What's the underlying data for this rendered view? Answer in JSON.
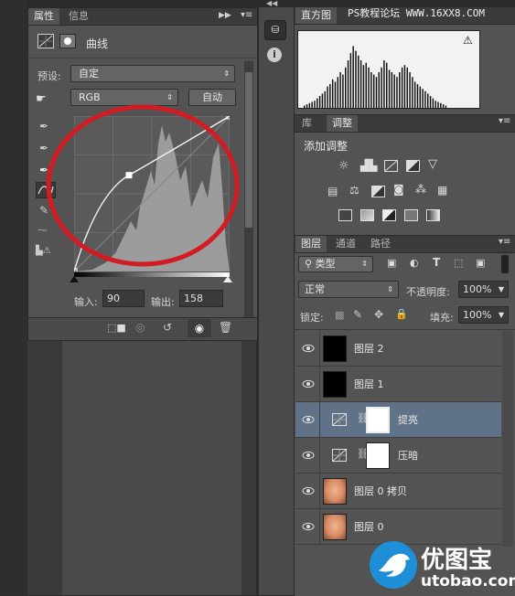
{
  "watermark_top": "PS教程论坛 WWW.16XX8.COM",
  "properties": {
    "tabs": [
      "属性",
      "信息"
    ],
    "title": "曲线",
    "preset_label": "预设:",
    "preset_value": "自定",
    "channel_value": "RGB",
    "auto_button": "自动",
    "input_label": "输入:",
    "input_value": "90",
    "output_label": "输出:",
    "output_value": "158",
    "curve_points": [
      [
        0,
        0
      ],
      [
        90,
        158
      ],
      [
        255,
        255
      ]
    ]
  },
  "histogram": {
    "tab": "直方图"
  },
  "adjustments": {
    "tabs": [
      "库",
      "调整"
    ],
    "add_label": "添加调整"
  },
  "layers": {
    "tabs": [
      "图层",
      "通道",
      "路径"
    ],
    "filter_label": "类型",
    "blend_mode": "正常",
    "opacity_label": "不透明度:",
    "opacity_value": "100%",
    "lock_label": "锁定:",
    "fill_label": "填充:",
    "fill_value": "100%",
    "items": [
      {
        "name": "图层 2"
      },
      {
        "name": "图层 1"
      },
      {
        "name": "提亮"
      },
      {
        "name": "压暗"
      },
      {
        "name": "图层 0 拷贝"
      },
      {
        "name": "图层 0"
      }
    ]
  },
  "logo": {
    "text": "优图宝",
    "url": "utobao.com"
  },
  "colors": {
    "panel_bg": "#535353",
    "selected_row": "#5f7287",
    "annotation_circle": "#d21c24",
    "logo_blue": "#1e8fd6"
  }
}
